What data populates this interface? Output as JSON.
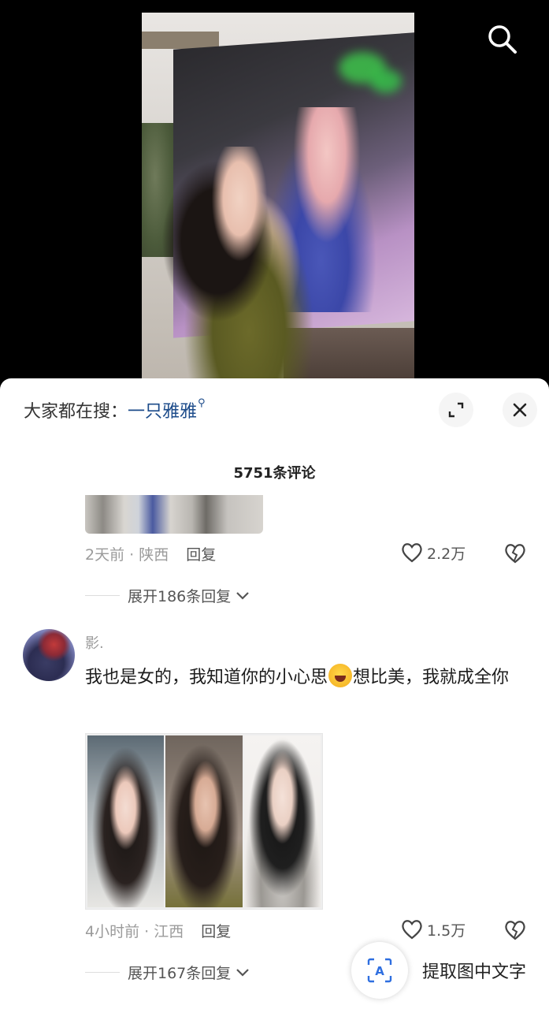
{
  "search_hint": {
    "prefix": "大家都在搜：",
    "keyword": "一只雅雅"
  },
  "comments_header": {
    "count_label": "5751条评论"
  },
  "comment_prev": {
    "time_location": "2天前 · 陕西",
    "reply_label": "回复",
    "likes": "2.2万",
    "expand_replies": "展开186条回复"
  },
  "comment_main": {
    "username": "影.",
    "text_part1": "我也是女的，我知道你的小心思",
    "emoji": "laughing-crying-emoji",
    "text_part2": "想比美，我就成全你",
    "time_location": "4小时前 · 江西",
    "reply_label": "回复",
    "likes": "1.5万",
    "expand_replies": "展开167条回复"
  },
  "extract_button": {
    "label": "提取图中文字",
    "icon_letter": "A"
  }
}
